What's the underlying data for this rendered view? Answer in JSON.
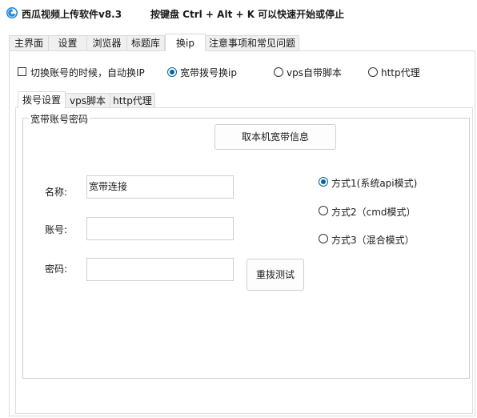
{
  "window": {
    "title": "西瓜视频上传软件v8.3",
    "hotkey_hint": "按键盘 Ctrl + Alt + K  可以快速开始或停止"
  },
  "main_tabs": [
    {
      "label": "主界面"
    },
    {
      "label": "设置"
    },
    {
      "label": "浏览器"
    },
    {
      "label": "标题库"
    },
    {
      "label": "换ip"
    },
    {
      "label": "注意事项和常见问题"
    }
  ],
  "top_options": {
    "switch_checkbox": {
      "label": "切换账号的时候，自动换IP",
      "checked": false
    },
    "radios": [
      {
        "label": "宽带拨号换ip",
        "selected": true
      },
      {
        "label": "vps自带脚本",
        "selected": false
      },
      {
        "label": "http代理",
        "selected": false
      }
    ]
  },
  "inner_tabs": [
    {
      "label": "拨号设置"
    },
    {
      "label": "vps脚本"
    },
    {
      "label": "http代理"
    }
  ],
  "group": {
    "legend": "宽带账号密码",
    "fetch_button": "取本机宽带信息",
    "name_label": "名称:",
    "name_value": "宽带连接",
    "account_label": "账号:",
    "account_value": "",
    "password_label": "密码:",
    "password_value": "",
    "redial_button": "重拨测试",
    "modes": [
      {
        "label": "方式1(系统api模式)",
        "selected": true
      },
      {
        "label": "方式2（cmd模式）",
        "selected": false
      },
      {
        "label": "方式3（混合模式）",
        "selected": false
      }
    ]
  },
  "colors": {
    "accent": "#0063b1",
    "tab_bg": "#f0f0f0",
    "border": "#d9d9d9"
  }
}
